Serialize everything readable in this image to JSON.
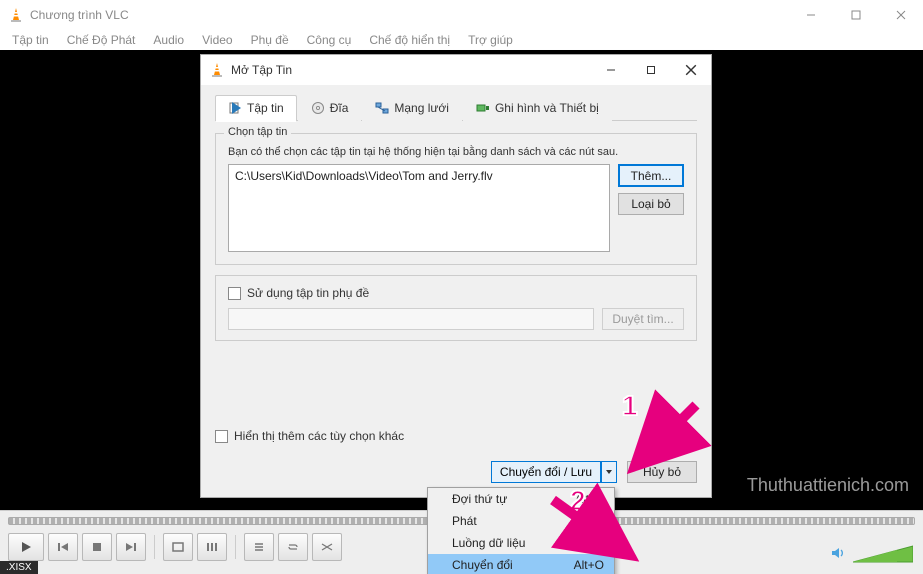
{
  "window": {
    "title": "Chương trình VLC",
    "menu": [
      "Tập tin",
      "Chế Độ Phát",
      "Audio",
      "Video",
      "Phụ đề",
      "Công cụ",
      "Chế độ hiển thị",
      "Trợ giúp"
    ]
  },
  "status_bottom": ".XISX",
  "watermark": "Thuthuattienich.com",
  "dialog": {
    "title": "Mở Tập Tin",
    "tabs": [
      {
        "id": "file",
        "label": "Tập tin"
      },
      {
        "id": "disc",
        "label": "Đĩa"
      },
      {
        "id": "net",
        "label": "Mạng lưới"
      },
      {
        "id": "cap",
        "label": "Ghi hình và Thiết bị"
      }
    ],
    "group_title": "Chọn tập tin",
    "hint": "Bạn có thể chọn các tập tin tại hệ thống hiện tại bằng danh sách và các nút sau.",
    "selected_file": "C:\\Users\\Kid\\Downloads\\Video\\Tom and Jerry.flv",
    "add_btn": "Thêm...",
    "remove_btn": "Loại bỏ",
    "use_subtitle": "Sử dụng tập tin phụ đề",
    "browse_btn": "Duyệt tìm...",
    "more_options": "Hiển thị thêm các tùy chọn khác",
    "convert_save": "Chuyển đổi / Lưu",
    "cancel": "Hủy bỏ",
    "menu": [
      {
        "label": "Đợi thứ tự",
        "shortcut": "Alt+E"
      },
      {
        "label": "Phát",
        "shortcut": "Alt+P"
      },
      {
        "label": "Luồng dữ liệu",
        "shortcut": "Alt+S"
      },
      {
        "label": "Chuyển đổi",
        "shortcut": "Alt+O"
      }
    ]
  },
  "annotations": {
    "n1": "1",
    "n2": "2"
  }
}
